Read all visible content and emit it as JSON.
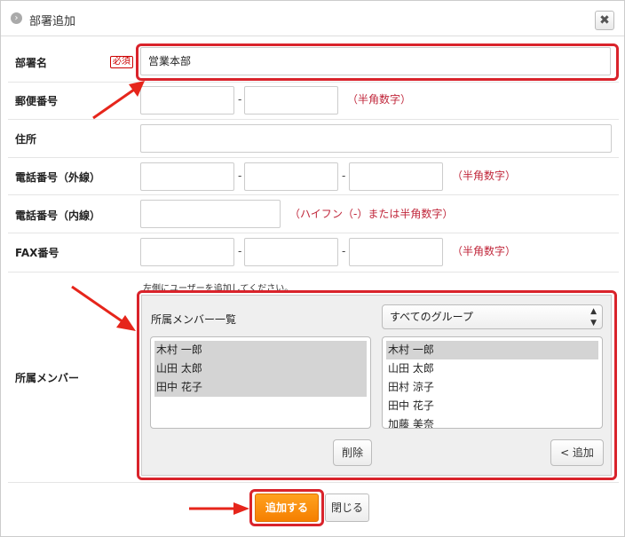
{
  "dialog": {
    "title": "部署追加",
    "close_label": "✖"
  },
  "form": {
    "department_name": {
      "label": "部署名",
      "required_badge": "必須",
      "value": "営業本部"
    },
    "postal_code": {
      "label": "郵便番号",
      "separator": "-",
      "hint": "（半角数字）"
    },
    "address": {
      "label": "住所"
    },
    "phone_external": {
      "label": "電話番号（外線）",
      "separator": "-",
      "hint": "（半角数字）"
    },
    "phone_internal": {
      "label": "電話番号（内線）",
      "hint": "（ハイフン（-）または半角数字）"
    },
    "fax": {
      "label": "FAX番号",
      "separator": "-",
      "hint": "（半角数字）"
    },
    "members": {
      "label": "所属メンバー",
      "note": "左側にユーザーを追加してください。",
      "list_title": "所属メンバー一覧",
      "group_select": {
        "value": "すべてのグループ",
        "arrows": "▲▼"
      },
      "assigned": [
        "木村 一郎",
        "山田 太郎",
        "田中 花子"
      ],
      "available": [
        "木村 一郎",
        "山田 太郎",
        "田村 涼子",
        "田中 花子",
        "加藤 美奈"
      ],
      "delete_label": "削除",
      "add_label": "< 追加"
    }
  },
  "footer": {
    "submit_label": "追加する",
    "close_label": "閉じる"
  },
  "colors": {
    "accent_orange": "#f58a0b",
    "highlight_red": "#d9232b",
    "hint_red": "#c0263a"
  }
}
